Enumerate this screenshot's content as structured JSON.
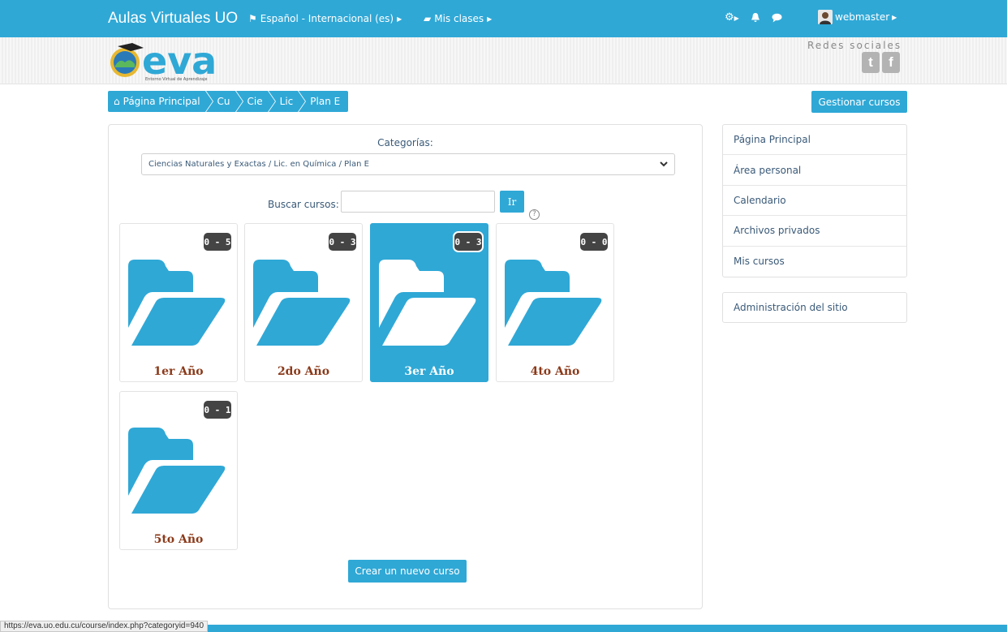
{
  "navbar": {
    "brand": "Aulas Virtuales UO",
    "language": "Español - Internacional (es)",
    "my_classes": "Mis clases",
    "user": "webmaster",
    "icons": [
      "gear-icon",
      "bell-icon",
      "chat-icon"
    ]
  },
  "header": {
    "logo_text": "eva",
    "logo_subtext": "Entorno Virtual de Aprendizaje",
    "social_title": "Redes sociales",
    "twitter_glyph": "t",
    "facebook_glyph": "f"
  },
  "breadcrumb": {
    "items": [
      "Página Principal",
      "Cu",
      "Cie",
      "Lic",
      "Plan E"
    ]
  },
  "manage_button": "Gestionar cursos",
  "categories": {
    "label": "Categorías:",
    "selected": "Ciencias Naturales y Exactas / Lic. en Química / Plan E"
  },
  "search": {
    "label": "Buscar cursos:",
    "value": "",
    "button": "Ir"
  },
  "folders": [
    {
      "title": "1er Año",
      "badge": "0 - 5"
    },
    {
      "title": "2do Año",
      "badge": "0 - 3"
    },
    {
      "title": "3er Año",
      "badge": "0 - 3"
    },
    {
      "title": "4to Año",
      "badge": "0 - 0"
    },
    {
      "title": "5to Año",
      "badge": "0 - 1"
    }
  ],
  "create_button": "Crear un nuevo curso",
  "sidebar": {
    "items": [
      "Página Principal",
      "Área personal",
      "Calendario",
      "Archivos privados",
      "Mis cursos"
    ],
    "admin": "Administración del sitio"
  },
  "status_url": "https://eva.uo.edu.cu/course/index.php?categoryid=940",
  "colors": {
    "primary": "#2fa8d6",
    "folder_title": "#8b3a1a",
    "badge": "#444444"
  }
}
